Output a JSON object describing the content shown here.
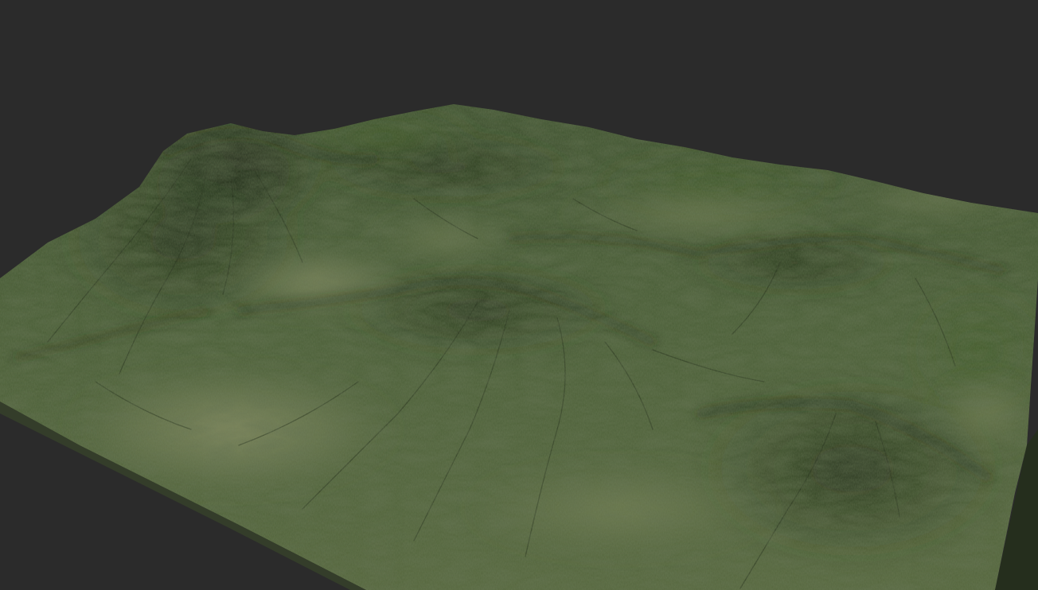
{
  "scene": {
    "type": "3d-terrain-render",
    "background_color": "#2b2b2b",
    "terrain_colors": {
      "base": "#4b5d36",
      "dark_green": "#2c3a1f",
      "mid_green": "#52663a",
      "light_olive": "#7c8658",
      "pale_flat": "#8a9068",
      "shadow": "#1c2614"
    },
    "features": [
      "mountain-peak",
      "ridges",
      "valleys",
      "plateaus",
      "erosion-channels"
    ]
  }
}
